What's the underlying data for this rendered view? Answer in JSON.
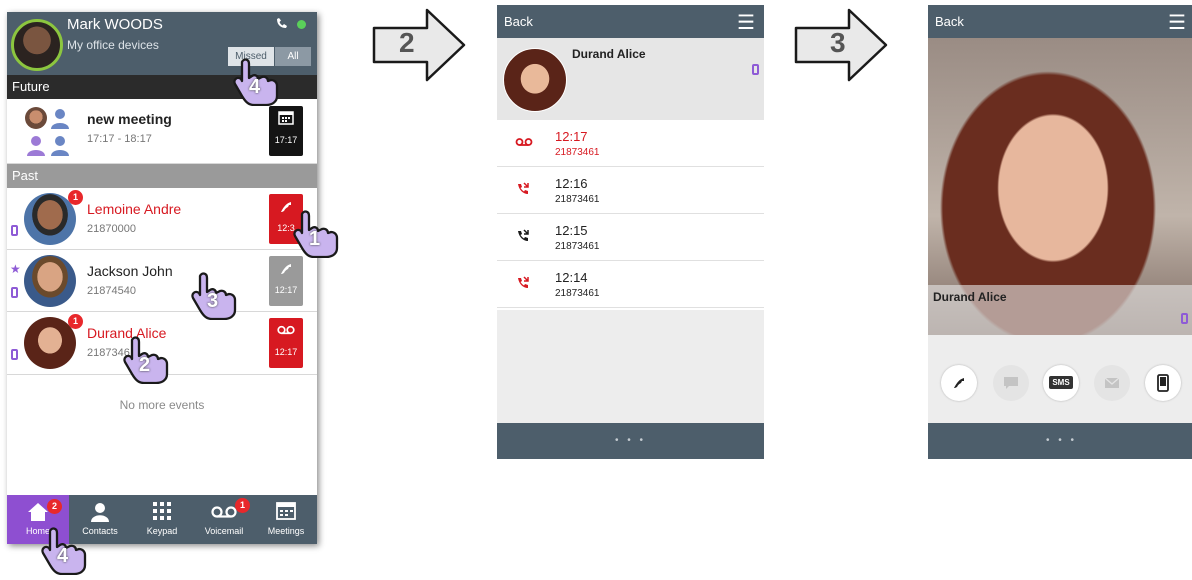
{
  "screen1": {
    "user": {
      "name": "Mark WOODS",
      "subtitle": "My office devices"
    },
    "filter": {
      "missed": "Missed",
      "all": "All"
    },
    "sections": {
      "future": "Future",
      "past": "Past"
    },
    "meeting": {
      "title": "new meeting",
      "time": "17:17 - 18:17",
      "tile_time": "17:17"
    },
    "events": [
      {
        "name": "Lemoine Andre",
        "number": "21870000",
        "badge": "1",
        "tile_time": "12:3",
        "missed": true
      },
      {
        "name": "Jackson John",
        "number": "21874540",
        "badge": "",
        "tile_time": "12:17",
        "missed": false
      },
      {
        "name": "Durand Alice",
        "number": "2187346",
        "badge": "1",
        "tile_time": "12:17",
        "missed": true
      }
    ],
    "no_more": "No more events",
    "nav": [
      {
        "label": "Home",
        "badge": "2"
      },
      {
        "label": "Contacts",
        "badge": ""
      },
      {
        "label": "Keypad",
        "badge": ""
      },
      {
        "label": "Voicemail",
        "badge": "1"
      },
      {
        "label": "Meetings",
        "badge": ""
      }
    ],
    "step_markers": [
      "1",
      "3",
      "2",
      "4",
      "4"
    ]
  },
  "arrows": [
    "2",
    "3"
  ],
  "screen2": {
    "back": "Back",
    "contact_name": "Durand Alice",
    "calls": [
      {
        "time": "12:17",
        "number": "21873461",
        "type": "voicemail"
      },
      {
        "time": "12:16",
        "number": "21873461",
        "type": "missed"
      },
      {
        "time": "12:15",
        "number": "21873461",
        "type": "answered"
      },
      {
        "time": "12:14",
        "number": "21873461",
        "type": "missed"
      }
    ],
    "page_dots": "• • •"
  },
  "screen3": {
    "back": "Back",
    "contact_name": "Durand Alice",
    "actions": [
      {
        "name": "call",
        "enabled": true
      },
      {
        "name": "chat",
        "enabled": false
      },
      {
        "name": "sms",
        "label": "SMS",
        "enabled": true
      },
      {
        "name": "email",
        "enabled": false
      },
      {
        "name": "mobile",
        "enabled": true
      }
    ],
    "page_dots": "• • •"
  },
  "colors": {
    "header": "#4d5e6b",
    "missed_red": "#d71921",
    "accent_purple": "#8e4fd1",
    "online_green": "#5ad05a"
  }
}
